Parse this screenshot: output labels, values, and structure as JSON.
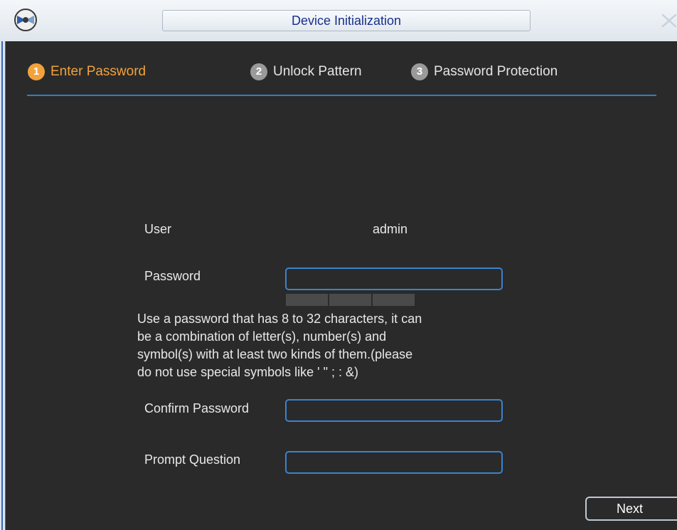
{
  "window": {
    "title": "Device Initialization"
  },
  "steps": [
    {
      "number": "1",
      "label": "Enter Password",
      "active": true
    },
    {
      "number": "2",
      "label": "Unlock Pattern",
      "active": false
    },
    {
      "number": "3",
      "label": "Password Protection",
      "active": false
    }
  ],
  "form": {
    "user_label": "User",
    "user_value": "admin",
    "password_label": "Password",
    "password_value": "",
    "hint": "Use a password that has 8 to 32 characters, it can\n be a combination of letter(s), number(s) and\nsymbol(s) with at least two kinds of them.(please\ndo not use special symbols like ' \" ; : &)",
    "confirm_label": "Confirm Password",
    "confirm_value": "",
    "prompt_label": "Prompt Question",
    "prompt_value": ""
  },
  "buttons": {
    "next_label": "Next"
  },
  "icons": {
    "app": "app-logo-icon",
    "close": "close-icon"
  },
  "colors": {
    "active_step": "#f2a23b",
    "field_border": "#3b82d0",
    "title_text": "#1a2e8c"
  }
}
